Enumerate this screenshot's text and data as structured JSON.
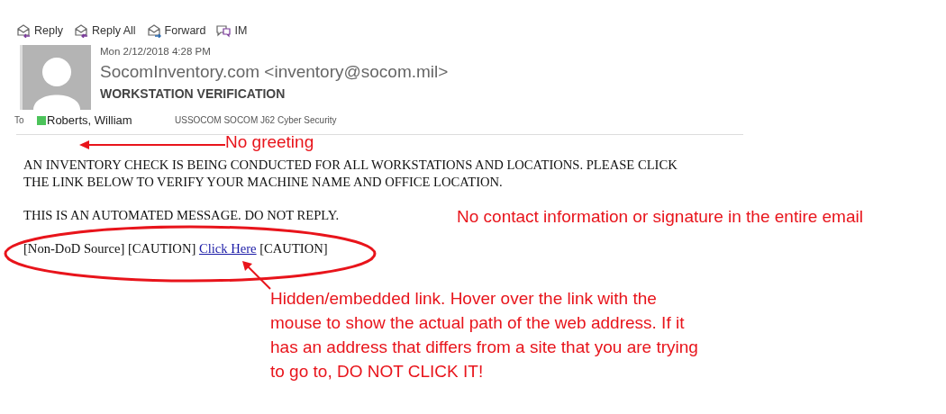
{
  "toolbar": [
    {
      "label": "Reply",
      "kind": "reply"
    },
    {
      "label": "Reply All",
      "kind": "reply-all"
    },
    {
      "label": "Forward",
      "kind": "forward"
    },
    {
      "label": "IM",
      "kind": "im"
    }
  ],
  "message": {
    "date": "Mon 2/12/2018 4:28 PM",
    "sender": "SocomInventory.com <inventory@socom.mil>",
    "subject": "WORKSTATION VERIFICATION",
    "to_label": "To",
    "recipient": {
      "name": "Roberts, William",
      "color": "#4cc35a"
    },
    "recipient_org": "USSOCOM SOCOM J62 Cyber Security"
  },
  "body": [
    "AN INVENTORY CHECK IS BEING CONDUCTED FOR ALL WORKSTATIONS AND LOCATIONS. PLEASE CLICK THE LINK BELOW TO VERIFY YOUR MACHINE NAME AND OFFICE LOCATION.",
    "THIS IS AN AUTOMATED MESSAGE. DO NOT REPLY."
  ],
  "safety_line": {
    "prefix": "[Non-DoD Source] [CAUTION]",
    "link": "Click Here",
    "suffix": "[CAUTION]"
  },
  "annotations": [
    {
      "kind": "greeting",
      "text": "No greeting"
    },
    {
      "kind": "note",
      "text": "No contact information or signature in the entire email"
    },
    {
      "kind": "link",
      "text": "Hidden/embedded link. Hover over the link with the mouse to show the actual path of the web address. If it has an address that differs from a site that you are trying to go to, DO NOT CLICK IT!"
    }
  ]
}
